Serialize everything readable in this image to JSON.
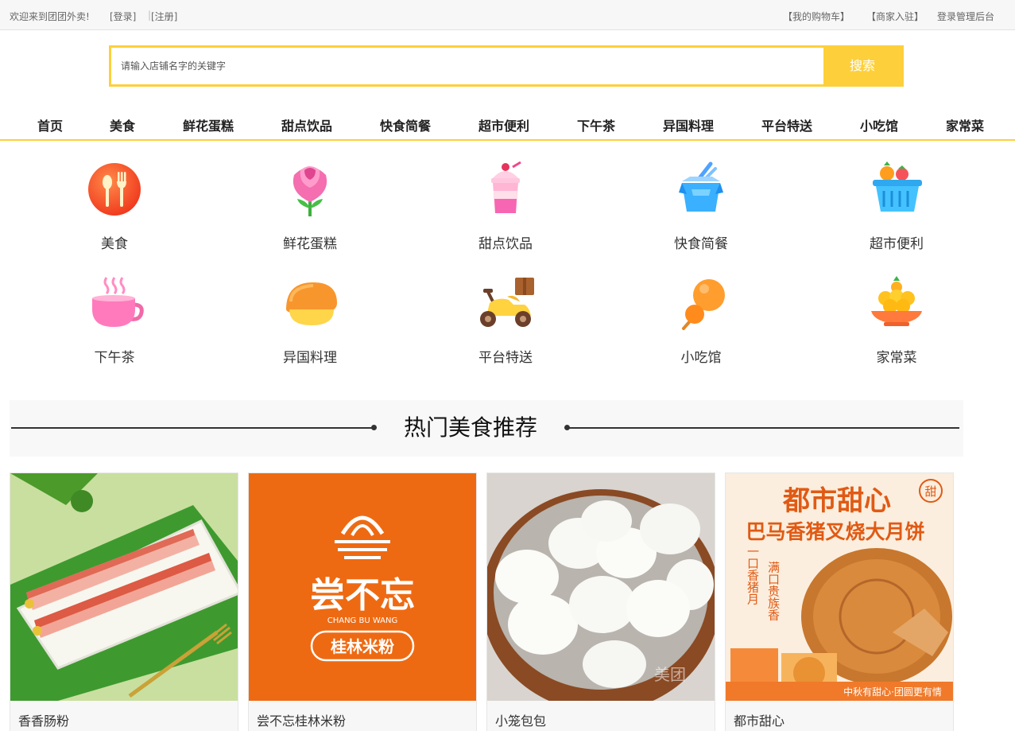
{
  "topbar": {
    "welcome": "欢迎来到团团外卖!",
    "login": "[登录]",
    "register": "[注册]",
    "cart": "【我的购物车】",
    "merchant": "【商家入驻】",
    "admin": "登录管理后台"
  },
  "search": {
    "placeholder": "请输入店铺名字的关键字",
    "button": "搜索"
  },
  "nav": [
    "首页",
    "美食",
    "鲜花蛋糕",
    "甜点饮品",
    "快食简餐",
    "超市便利",
    "下午茶",
    "异国料理",
    "平台特送",
    "小吃馆",
    "家常菜"
  ],
  "categories": [
    {
      "label": "美食",
      "icon": "fork-spoon-icon"
    },
    {
      "label": "鲜花蛋糕",
      "icon": "rose-icon"
    },
    {
      "label": "甜点饮品",
      "icon": "milkshake-icon"
    },
    {
      "label": "快食简餐",
      "icon": "takeout-box-icon"
    },
    {
      "label": "超市便利",
      "icon": "shopping-basket-icon"
    },
    {
      "label": "下午茶",
      "icon": "tea-cup-icon"
    },
    {
      "label": "异国料理",
      "icon": "sushi-icon"
    },
    {
      "label": "平台特送",
      "icon": "delivery-scooter-icon"
    },
    {
      "label": "小吃馆",
      "icon": "skewer-icon"
    },
    {
      "label": "家常菜",
      "icon": "dish-icon"
    }
  ],
  "section_title": "热门美食推荐",
  "products": [
    {
      "name": "香香肠粉"
    },
    {
      "name": "尝不忘桂林米粉",
      "logo_text": "尝不忘",
      "logo_pinyin": "CHANG BU WANG",
      "logo_sub": "桂林米粉"
    },
    {
      "name": "小笼包包",
      "watermark": "美团"
    },
    {
      "name": "都市甜心",
      "poster_title": "都市甜心",
      "poster_subtitle": "巴马香猪叉烧大月饼",
      "poster_badge": "甜",
      "poster_left": "一口香猪月",
      "poster_right": "满口贵族香",
      "poster_footer": "中秋有甜心·团圆更有情"
    }
  ],
  "colors": {
    "accent": "#fdd03b",
    "brand_orange": "#ee6a12"
  }
}
